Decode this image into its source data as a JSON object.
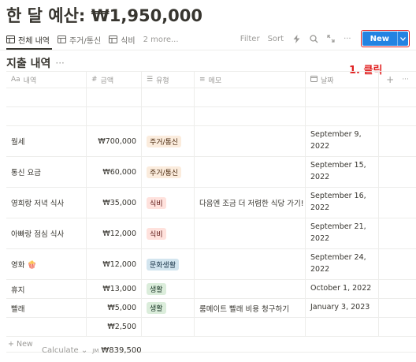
{
  "page": {
    "title": "한 달 예산: ₩1,950,000"
  },
  "tabs": [
    {
      "label": "전체 내역"
    },
    {
      "label": "주거/통신"
    },
    {
      "label": "식비"
    }
  ],
  "more_tabs_label": "2 more...",
  "toolbar": {
    "filter": "Filter",
    "sort": "Sort",
    "new_label": "New"
  },
  "annotation": "1. 클릭",
  "view": {
    "title": "지출 내역",
    "more": "···"
  },
  "columns": {
    "name": "내역",
    "amount": "금액",
    "type": "유형",
    "memo": "메모",
    "date": "날짜"
  },
  "rows": [
    {
      "name": "월세",
      "amount": "₩700,000",
      "type": "주거/통신",
      "memo": "",
      "date_line1": "September 9,",
      "date_line2": "2022"
    },
    {
      "name": "통신 요금",
      "amount": "₩60,000",
      "type": "주거/통신",
      "memo": "",
      "date_line1": "September 15,",
      "date_line2": "2022"
    },
    {
      "name": "영희랑 저녁 식사",
      "amount": "₩35,000",
      "type": "식비",
      "memo": "다음엔 조금 더 저렴한 식당 가기!",
      "date_line1": "September 16,",
      "date_line2": "2022"
    },
    {
      "name": "아빠랑 점심 식사",
      "amount": "₩12,000",
      "type": "식비",
      "memo": "",
      "date_line1": "September 21,",
      "date_line2": "2022"
    },
    {
      "name": "영화 🍿",
      "amount": "₩12,000",
      "type": "문화생활",
      "memo": "",
      "date_line1": "September 24,",
      "date_line2": "2022"
    },
    {
      "name": "휴지",
      "amount": "₩13,000",
      "type": "생활",
      "memo": "",
      "date_line1": "October 1, 2022",
      "date_line2": ""
    },
    {
      "name": "빨래",
      "amount": "₩5,000",
      "type": "생활",
      "memo": "룸메이트 빨래 비용 청구하기",
      "date_line1": "January 3, 2023",
      "date_line2": ""
    },
    {
      "name": "",
      "amount": "₩2,500",
      "type": "",
      "memo": "",
      "date_line1": "",
      "date_line2": ""
    }
  ],
  "tag_colors": {
    "주거/통신": {
      "bg": "#fbecdd",
      "fg": "#49290e"
    },
    "식비": {
      "bg": "#ffe2dd",
      "fg": "#5d1715"
    },
    "문화생활": {
      "bg": "#d3e5ef",
      "fg": "#183347"
    },
    "생활": {
      "bg": "#dbeddb",
      "fg": "#1c3829"
    }
  },
  "footer": {
    "new_row": "+ New",
    "calculate": "Calculate",
    "sum_prefix": "JM",
    "sum": "₩839,500"
  },
  "colors": {
    "accent": "#2383e2",
    "annotation": "#e02020"
  }
}
